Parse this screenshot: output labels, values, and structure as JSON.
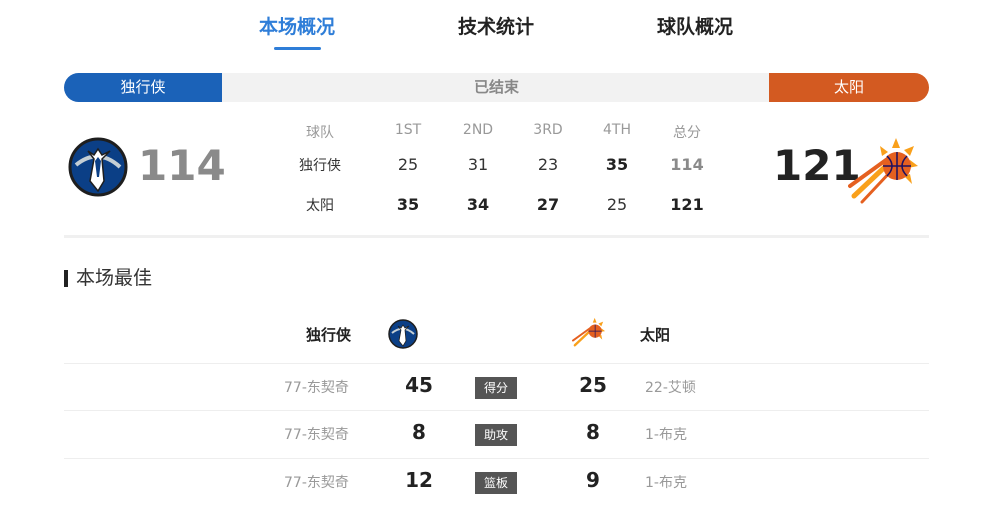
{
  "tabs": [
    {
      "label": "本场概况",
      "active": true
    },
    {
      "label": "技术统计",
      "active": false
    },
    {
      "label": "球队概况",
      "active": false
    }
  ],
  "status_bar": {
    "away_team": "独行侠",
    "status": "已结束",
    "home_team": "太阳"
  },
  "colors": {
    "accent": "#2f7ed8",
    "away": "#1b62b8",
    "home": "#d35a21"
  },
  "score": {
    "away_total": "114",
    "home_total": "121",
    "away_logo_icon": "mavericks-logo-icon",
    "home_logo_icon": "suns-logo-icon"
  },
  "quarters": {
    "headers": [
      "球队",
      "1ST",
      "2ND",
      "3RD",
      "4TH",
      "总分"
    ],
    "rows": [
      {
        "team": "独行侠",
        "q": [
          "25",
          "31",
          "23",
          "35"
        ],
        "total": "114"
      },
      {
        "team": "太阳",
        "q": [
          "35",
          "34",
          "27",
          "25"
        ],
        "total": "121"
      }
    ]
  },
  "best": {
    "title": "本场最佳",
    "away_team": "独行侠",
    "home_team": "太阳",
    "rows": [
      {
        "away_player": "77-东契奇",
        "away_value": "45",
        "category": "得分",
        "home_value": "25",
        "home_player": "22-艾顿"
      },
      {
        "away_player": "77-东契奇",
        "away_value": "8",
        "category": "助攻",
        "home_value": "8",
        "home_player": "1-布克"
      },
      {
        "away_player": "77-东契奇",
        "away_value": "12",
        "category": "篮板",
        "home_value": "9",
        "home_player": "1-布克"
      }
    ]
  }
}
